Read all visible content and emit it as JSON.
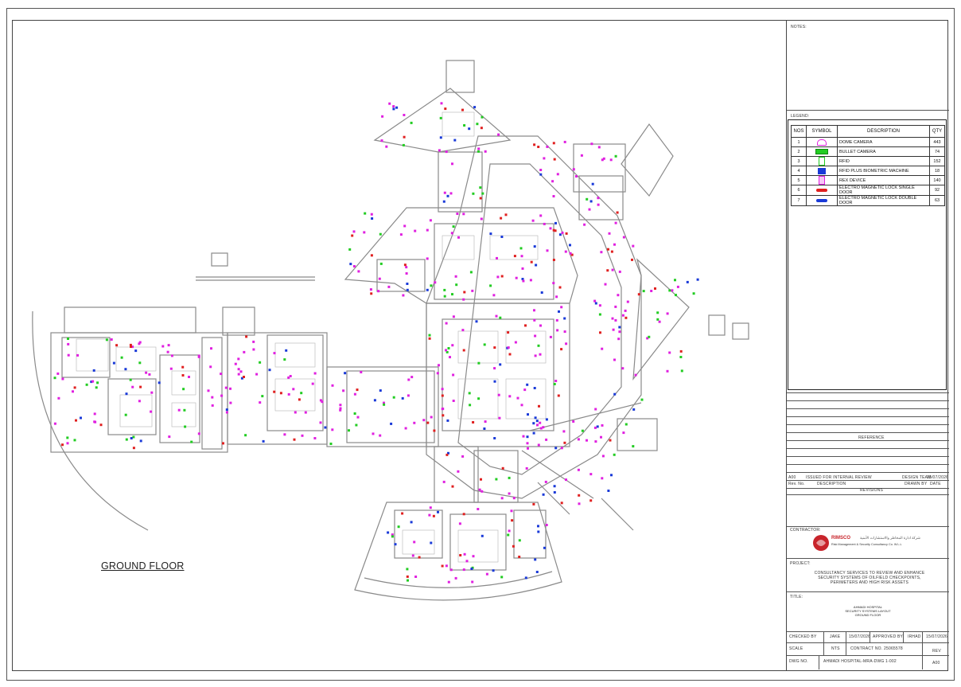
{
  "drawing": {
    "title": "GROUND FLOOR"
  },
  "titleblock": {
    "notes_label": "NOTES:",
    "legend_label": "LEGEND:",
    "legend_headers": [
      "NOS",
      "SYMBOL",
      "DESCRIPTION",
      "QTY"
    ],
    "legend_rows": [
      {
        "no": "1",
        "desc": "DOME CAMERA",
        "qty": "443",
        "icon": "dome-camera-icon",
        "color": "#e020e0"
      },
      {
        "no": "2",
        "desc": "BULLET CAMERA",
        "qty": "74",
        "icon": "bullet-camera-icon",
        "color": "#22cc22"
      },
      {
        "no": "3",
        "desc": "RFID",
        "qty": "152",
        "icon": "rfid-icon",
        "color": "#22cc22"
      },
      {
        "no": "4",
        "desc": "RFID PLUS BIOMETRIC MACHINE",
        "qty": "18",
        "icon": "biometric-icon",
        "color": "#1a3ad8"
      },
      {
        "no": "5",
        "desc": "REX DEVICE",
        "qty": "140",
        "icon": "rex-device-icon",
        "color": "#e020e0"
      },
      {
        "no": "6",
        "desc": "ELECTRO MAGNETIC LOCK SINGLE DOOR",
        "qty": "92",
        "icon": "single-lock-icon",
        "color": "#e02020"
      },
      {
        "no": "7",
        "desc": "ELECTRO MAGNETIC LOCK DOUBLE DOOR",
        "qty": "63",
        "icon": "double-lock-icon",
        "color": "#1a3ad8"
      }
    ],
    "reference_label": "REFERENCE",
    "revision": {
      "rev": "A00",
      "description": "ISSUED FOR INTERNAL REVIEW",
      "drawn_by": "DESIGN TEAM",
      "date": "15/07/2026",
      "col_rev": "Rev. No.",
      "col_desc": "DESCRIPTION",
      "col_drawn": "DRAWN BY",
      "col_date": "DATE",
      "label": "REVISIONS"
    },
    "contractor_label": "CONTRACTOR:",
    "contractor_name": "RIMSCO",
    "contractor_sub": "Risk Management & Security Consultancy Co. W.L.L",
    "contractor_arabic": "شركة ادارة المخاطر والاستشارات الأمنية",
    "project_label": "PROJECT:",
    "project_text": "CONSULTANCY SERVICES TO REVIEW AND ENHANCE SECURITY SYSTEMS OF OILFIELD CHECKPOINTS, PERIMETERS AND HIGH RISK ASSETS",
    "title_label": "TITLE:",
    "title_line1": "AHMADI HOSPITAL",
    "title_line2": "SECURITY SYSTEMS LAYOUT",
    "title_line3": "GROUND FLOOR",
    "checked_by_label": "CHECKED BY",
    "checked_by": "JAKE",
    "checked_date": "15/07/2026",
    "approved_by_label": "APPROVED BY",
    "approved_by": "IRHAD",
    "approved_date": "15/07/2026",
    "scale_label": "SCALE",
    "scale": "NTS",
    "contract_label": "CONTRACT NO.",
    "contract_no": "25065578",
    "rev_label": "REV",
    "dwg_label": "DWG NO.",
    "dwg_no": "AHMADI HOSPITAL-MRA-DWG 1-002",
    "rev_no": "A00"
  }
}
